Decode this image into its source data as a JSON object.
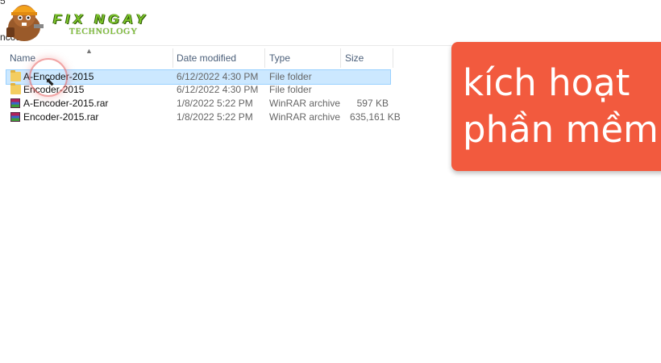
{
  "window": {
    "top_crumb": "5",
    "path_crumb": "ncod"
  },
  "logo": {
    "title": "FIX NGAY",
    "subtitle": "TECHNOLOGY"
  },
  "columns": {
    "name": "Name",
    "date": "Date modified",
    "type": "Type",
    "size": "Size"
  },
  "files": [
    {
      "name": "A-Encoder-2015",
      "date": "6/12/2022 4:30 PM",
      "type": "File folder",
      "size": "",
      "icon": "folder-icon",
      "selected": true
    },
    {
      "name": "Encoder-2015",
      "date": "6/12/2022 4:30 PM",
      "type": "File folder",
      "size": "",
      "icon": "folder-icon",
      "selected": false
    },
    {
      "name": "A-Encoder-2015.rar",
      "date": "1/8/2022 5:22 PM",
      "type": "WinRAR archive",
      "size": "597 KB",
      "icon": "winrar-icon",
      "selected": false
    },
    {
      "name": "Encoder-2015.rar",
      "date": "1/8/2022 5:22 PM",
      "type": "WinRAR archive",
      "size": "635,161 KB",
      "icon": "winrar-icon",
      "selected": false
    }
  ],
  "callout": {
    "line1": "kích hoạt",
    "line2": "phần mềm",
    "color": "#f25a3e"
  },
  "colors": {
    "selection_bg": "#cce8ff",
    "selection_border": "#99d1ff",
    "header_text": "#4c607a"
  }
}
